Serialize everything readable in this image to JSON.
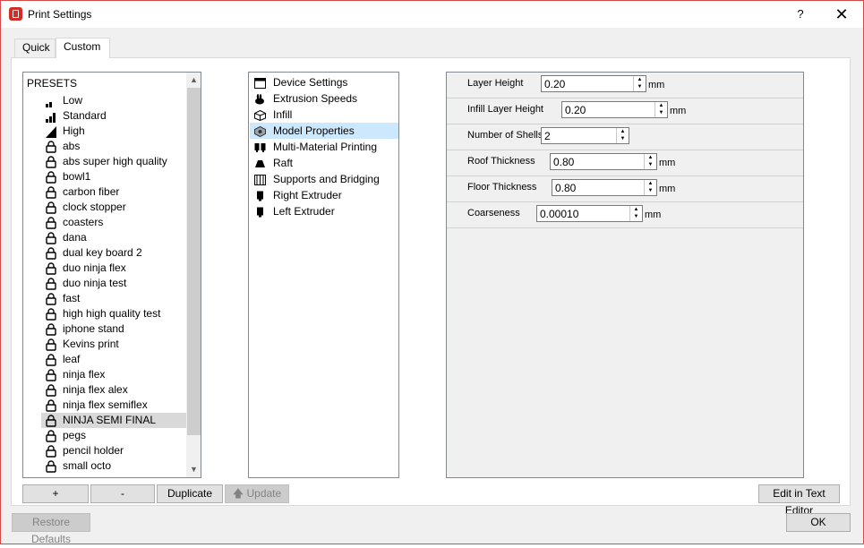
{
  "window": {
    "title": "Print Settings",
    "help_label": "?",
    "close_label": "✕"
  },
  "tabs": [
    {
      "label": "Quick"
    },
    {
      "label": "Custom"
    }
  ],
  "presets": {
    "header": "PRESETS",
    "items": [
      {
        "label": "Low",
        "icon": "signal-low-icon"
      },
      {
        "label": "Standard",
        "icon": "signal-medium-icon"
      },
      {
        "label": "High",
        "icon": "signal-high-icon"
      },
      {
        "label": "abs",
        "icon": "lock-icon"
      },
      {
        "label": "abs super high quality",
        "icon": "lock-icon"
      },
      {
        "label": "bowl1",
        "icon": "lock-icon"
      },
      {
        "label": "carbon fiber",
        "icon": "lock-icon"
      },
      {
        "label": "clock stopper",
        "icon": "lock-icon"
      },
      {
        "label": "coasters",
        "icon": "lock-icon"
      },
      {
        "label": "dana",
        "icon": "lock-icon"
      },
      {
        "label": "dual key board 2",
        "icon": "lock-icon"
      },
      {
        "label": "duo ninja flex",
        "icon": "lock-icon"
      },
      {
        "label": "duo ninja test",
        "icon": "lock-icon"
      },
      {
        "label": "fast",
        "icon": "lock-icon"
      },
      {
        "label": "high high quality test",
        "icon": "lock-icon"
      },
      {
        "label": "iphone stand",
        "icon": "lock-icon"
      },
      {
        "label": "Kevins print",
        "icon": "lock-icon"
      },
      {
        "label": "leaf",
        "icon": "lock-icon"
      },
      {
        "label": "ninja flex",
        "icon": "lock-icon"
      },
      {
        "label": "ninja flex alex",
        "icon": "lock-icon"
      },
      {
        "label": "ninja flex semiflex",
        "icon": "lock-icon"
      },
      {
        "label": "NINJA SEMI FINAL",
        "icon": "lock-icon",
        "selected": true
      },
      {
        "label": "pegs",
        "icon": "lock-icon"
      },
      {
        "label": "pencil holder",
        "icon": "lock-icon"
      },
      {
        "label": "small octo",
        "icon": "lock-icon"
      }
    ]
  },
  "categories": [
    {
      "label": "Device Settings",
      "icon": "window-icon"
    },
    {
      "label": "Extrusion Speeds",
      "icon": "rabbit-icon"
    },
    {
      "label": "Infill",
      "icon": "infill-cube-icon"
    },
    {
      "label": "Model Properties",
      "icon": "model-icon",
      "selected": true
    },
    {
      "label": "Multi-Material Printing",
      "icon": "multi-extruder-icon"
    },
    {
      "label": "Raft",
      "icon": "raft-icon"
    },
    {
      "label": "Supports and Bridging",
      "icon": "supports-icon"
    },
    {
      "label": "Right Extruder",
      "icon": "extruder-icon"
    },
    {
      "label": "Left Extruder",
      "icon": "extruder-icon"
    }
  ],
  "properties": [
    {
      "label": "Layer Height",
      "value": "0.20",
      "unit": "mm"
    },
    {
      "label": "Infill Layer Height",
      "value": "0.20",
      "unit": "mm"
    },
    {
      "label": "Number of Shells",
      "value": "2",
      "unit": ""
    },
    {
      "label": "Roof Thickness",
      "value": "0.80",
      "unit": "mm"
    },
    {
      "label": "Floor Thickness",
      "value": "0.80",
      "unit": "mm"
    },
    {
      "label": "Coarseness",
      "value": "0.00010",
      "unit": "mm"
    }
  ],
  "buttons": {
    "add": "+",
    "remove": "-",
    "duplicate": "Duplicate",
    "update": "Update",
    "edit_text_editor": "Edit in Text Editor",
    "restore_defaults": "Restore Defaults",
    "ok": "OK"
  },
  "colors": {
    "accent": "#d32d27",
    "selection": "#cce8ff",
    "preset_selection": "#d9d9d9"
  }
}
